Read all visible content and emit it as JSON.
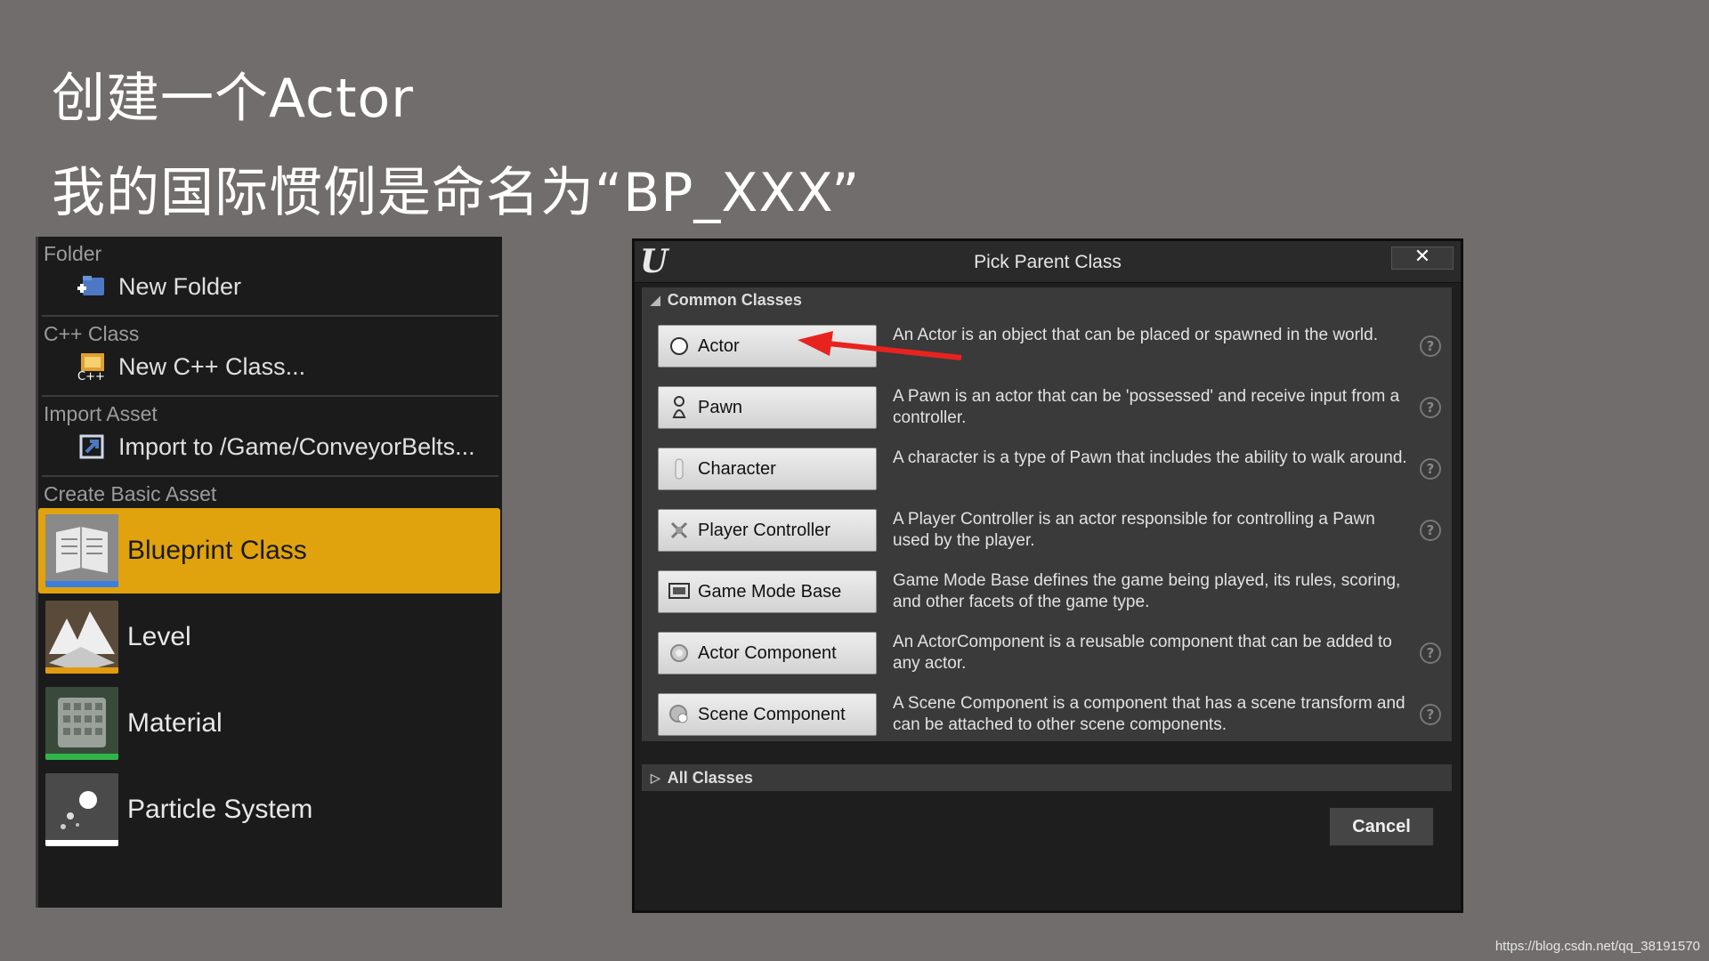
{
  "slide": {
    "title_line1": "创建一个Actor",
    "title_line2": "我的国际惯例是命名为“BP_XXX”",
    "watermark": "https://blog.csdn.net/qq_38191570"
  },
  "context_menu": {
    "sections": [
      {
        "header": "Folder",
        "item": "New Folder",
        "icon": "new-folder-icon"
      },
      {
        "header": "C++ Class",
        "item": "New C++ Class...",
        "icon": "cpp-class-icon"
      },
      {
        "header": "Import Asset",
        "item": "Import to /Game/ConveyorBelts...",
        "icon": "import-icon"
      }
    ],
    "basic_header": "Create Basic Asset",
    "basic_assets": [
      {
        "label": "Blueprint Class",
        "selected": true,
        "bar_color": "#3a7ee0"
      },
      {
        "label": "Level",
        "selected": false,
        "bar_color": "#e29a10"
      },
      {
        "label": "Material",
        "selected": false,
        "bar_color": "#2fb44a"
      },
      {
        "label": "Particle System",
        "selected": false,
        "bar_color": "#ffffff"
      }
    ],
    "selected_color": "#e0a30d"
  },
  "dialog": {
    "logo": "U",
    "title": "Pick Parent Class",
    "close": "✕",
    "common_header": "Common Classes",
    "all_header": "All Classes",
    "cancel": "Cancel",
    "classes": [
      {
        "name": "Actor",
        "desc": "An Actor is an object that can be placed or spawned in the world.",
        "help": true
      },
      {
        "name": "Pawn",
        "desc": "A Pawn is an actor that can be 'possessed' and receive input from a controller.",
        "help": true
      },
      {
        "name": "Character",
        "desc": "A character is a type of Pawn that includes the ability to walk around.",
        "help": true
      },
      {
        "name": "Player Controller",
        "desc": "A Player Controller is an actor responsible for controlling a Pawn used by the player.",
        "help": true
      },
      {
        "name": "Game Mode Base",
        "desc": "Game Mode Base defines the game being played, its rules, scoring, and other facets of the game type.",
        "help": false
      },
      {
        "name": "Actor Component",
        "desc": "An ActorComponent is a reusable component that can be added to any actor.",
        "help": true
      },
      {
        "name": "Scene Component",
        "desc": "A Scene Component is a component that has a scene transform and can be attached to other scene components.",
        "help": true
      }
    ]
  },
  "annotation": {
    "arrow_color": "#e8231e"
  }
}
